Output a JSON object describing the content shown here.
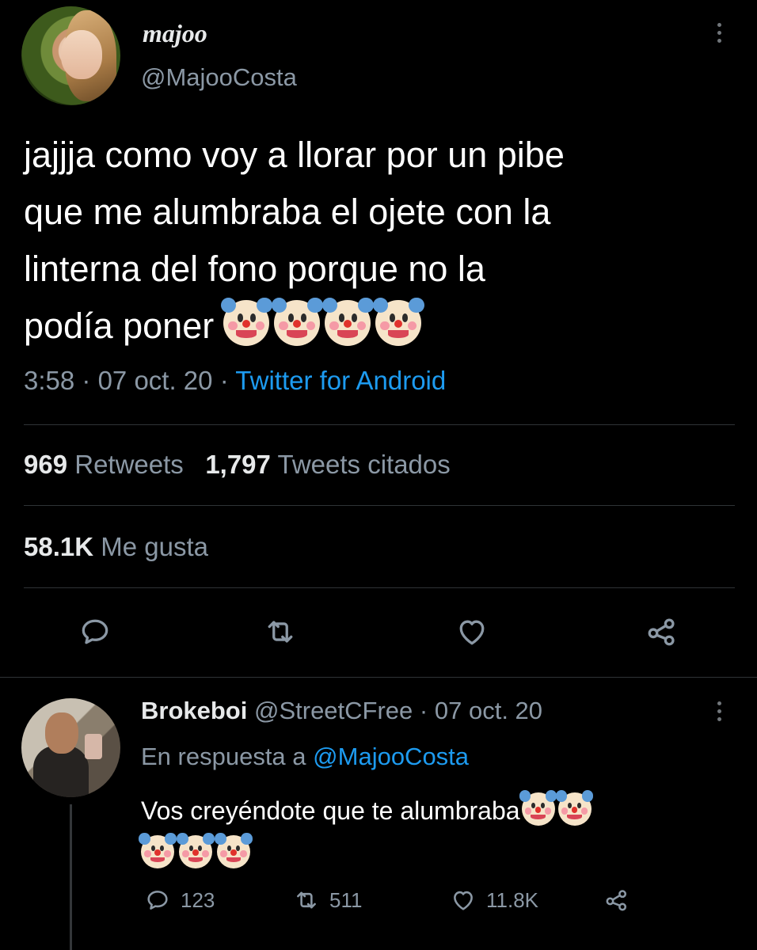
{
  "tweet": {
    "display_name": "majoo",
    "handle": "@MajooCosta",
    "text": "jajjja como voy a llorar por un pibe\nque me alumbraba el ojete con la\nlinterna del fono porque no la\npodía poner",
    "trailing_emoji": [
      "clown-face",
      "clown-face",
      "clown-face",
      "clown-face"
    ],
    "time": "3:58",
    "date": "07 oct. 20",
    "source": "Twitter for Android",
    "separator": "·",
    "stats": {
      "retweets_count": "969",
      "retweets_label": "Retweets",
      "quotes_count": "1,797",
      "quotes_label": "Tweets citados",
      "likes_count": "58.1K",
      "likes_label": "Me gusta"
    },
    "actions": [
      "reply-icon",
      "retweet-icon",
      "like-icon",
      "share-icon"
    ]
  },
  "reply": {
    "display_name": "Brokeboi",
    "handle": "@StreetCFree",
    "date": "07 oct. 20",
    "separator": "·",
    "in_reply_prefix": "En respuesta a",
    "in_reply_handle": "@MajooCosta",
    "text": "Vos creyéndote que te alumbraba",
    "trailing_emoji": [
      "clown-face",
      "clown-face",
      "clown-face",
      "clown-face",
      "clown-face"
    ],
    "reply_count": "123",
    "retweet_count": "511",
    "like_count": "11.8K"
  },
  "colors": {
    "background": "#000000",
    "text": "#e7e9ea",
    "secondary": "#8b98a5",
    "link": "#1d9bf0",
    "divider": "#2f3336"
  }
}
